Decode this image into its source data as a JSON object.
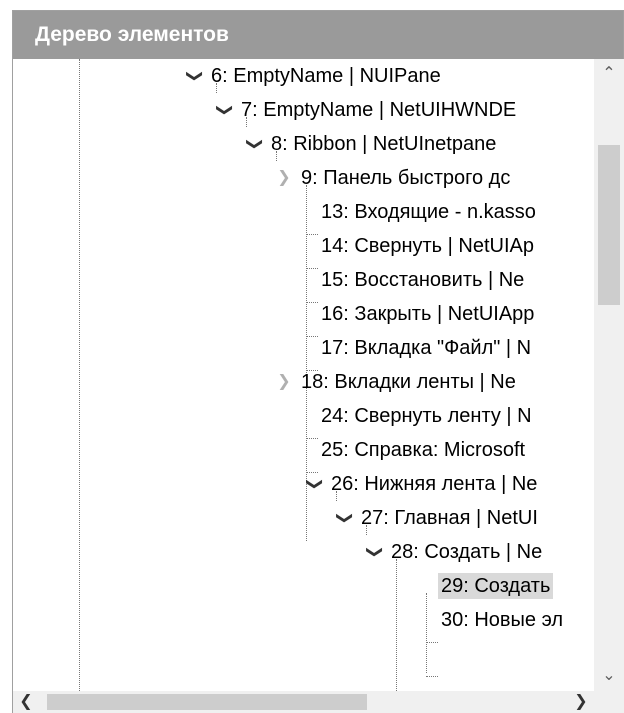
{
  "panel": {
    "title": "Дерево элементов"
  },
  "tree": {
    "rows": [
      {
        "label": "6: EmptyName | NUIPane",
        "toggle": "expanded"
      },
      {
        "label": "7: EmptyName | NetUIHWNDE",
        "toggle": "expanded"
      },
      {
        "label": "8: Ribbon | NetUInetpane",
        "toggle": "expanded"
      },
      {
        "label": "9: Панель быстрого дс",
        "toggle": "collapsed"
      },
      {
        "label": "13: Входящие - n.kasso",
        "toggle": "leaf"
      },
      {
        "label": "14: Свернуть | NetUIAp",
        "toggle": "leaf"
      },
      {
        "label": "15: Восстановить | Ne",
        "toggle": "leaf"
      },
      {
        "label": "16: Закрыть | NetUIApp",
        "toggle": "leaf"
      },
      {
        "label": "17: Вкладка \"Файл\" | N",
        "toggle": "leaf"
      },
      {
        "label": "18: Вкладки ленты | Ne",
        "toggle": "collapsed"
      },
      {
        "label": "24: Свернуть ленту | N",
        "toggle": "leaf"
      },
      {
        "label": "25: Справка: Microsoft",
        "toggle": "leaf"
      },
      {
        "label": "26: Нижняя лента | Ne",
        "toggle": "expanded"
      },
      {
        "label": "27: Главная | NetUI",
        "toggle": "expanded"
      },
      {
        "label": "28: Создать | Ne",
        "toggle": "expanded"
      },
      {
        "label": "29: Создать",
        "toggle": "leaf",
        "selected": true
      },
      {
        "label": "30: Новые эл",
        "toggle": "leaf"
      }
    ]
  },
  "icons": {
    "expanded": "chevron-down-icon",
    "collapsed": "chevron-right-icon",
    "scroll_up": "chevron-up-icon",
    "scroll_down": "chevron-down-icon",
    "scroll_left": "chevron-left-icon",
    "scroll_right": "chevron-right-icon"
  },
  "colors": {
    "header_bg": "#9a9a9a",
    "selection_bg": "#d9d9d9",
    "scrollbar_bg": "#f0f0f0",
    "scrollbar_thumb": "#cdcdcd"
  }
}
